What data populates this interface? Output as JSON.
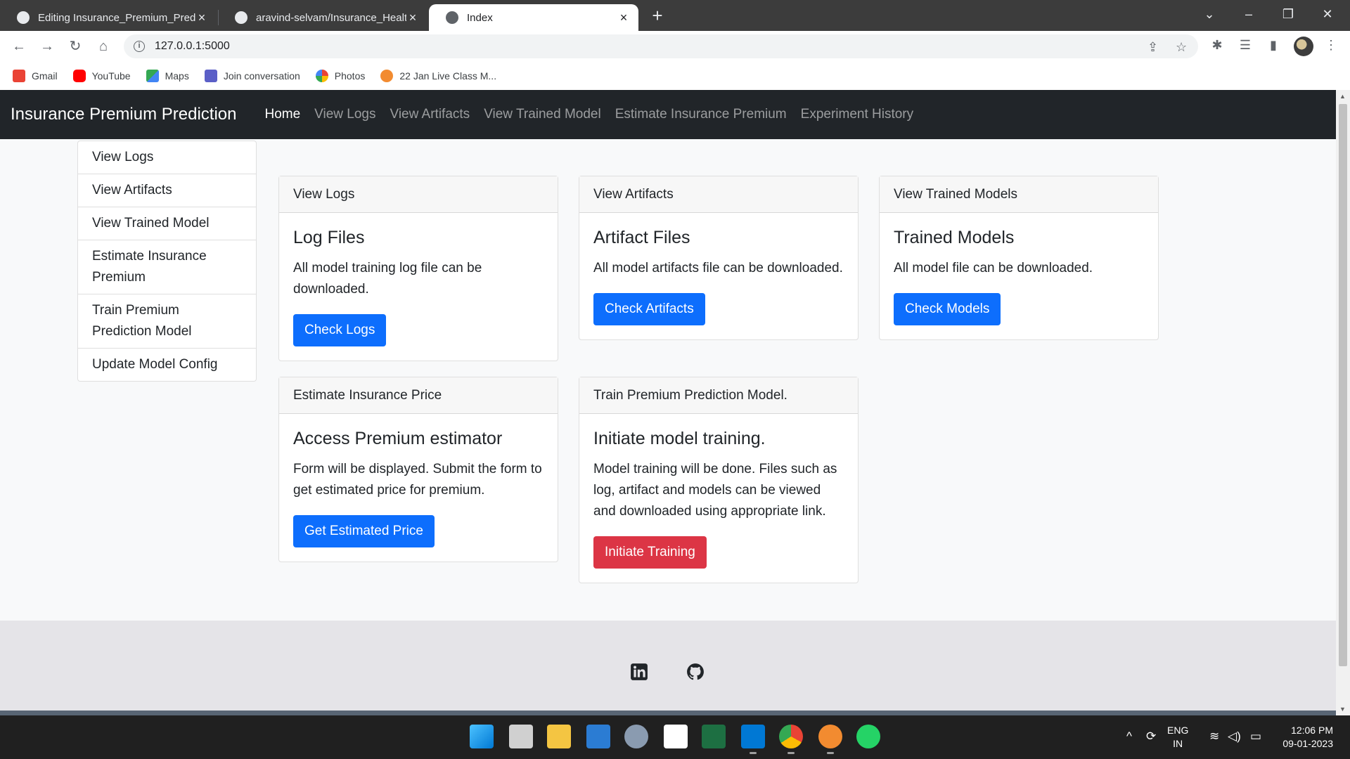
{
  "browser": {
    "tabs": [
      {
        "label": "Editing Insurance_Premium_Pred"
      },
      {
        "label": "aravind-selvam/Insurance_Health"
      },
      {
        "label": "Index"
      }
    ],
    "new_tab_glyph": "+",
    "url": "127.0.0.1:5000",
    "bookmarks": [
      {
        "label": "Gmail",
        "icon": "gmail-icon",
        "color": "#ea4335"
      },
      {
        "label": "YouTube",
        "icon": "youtube-icon",
        "color": "#ff0000"
      },
      {
        "label": "Maps",
        "icon": "maps-icon",
        "color": "#34a853"
      },
      {
        "label": "Join conversation",
        "icon": "teams-icon",
        "color": "#5b5fc7"
      },
      {
        "label": "Photos",
        "icon": "photos-icon",
        "color": "#fbbc04"
      },
      {
        "label": "22 Jan Live Class M...",
        "icon": "class-icon",
        "color": "#f28b30"
      }
    ]
  },
  "navbar": {
    "brand": "Insurance Premium Prediction",
    "links": [
      {
        "label": "Home",
        "active": true
      },
      {
        "label": "View Logs"
      },
      {
        "label": "View Artifacts"
      },
      {
        "label": "View Trained Model"
      },
      {
        "label": "Estimate Insurance Premium"
      },
      {
        "label": "Experiment History"
      }
    ]
  },
  "sidebar": {
    "items": [
      {
        "label": "View Logs"
      },
      {
        "label": "View Artifacts"
      },
      {
        "label": "View Trained Model"
      },
      {
        "label": "Estimate Insurance Premium"
      },
      {
        "label": "Train Premium Prediction Model"
      },
      {
        "label": "Update Model Config"
      }
    ]
  },
  "cards": [
    {
      "header": "View Logs",
      "title": "Log Files",
      "text": "All model training log file can be downloaded.",
      "button": "Check Logs",
      "variant": "primary"
    },
    {
      "header": "View Artifacts",
      "title": "Artifact Files",
      "text": "All model artifacts file can be downloaded.",
      "button": "Check Artifacts",
      "variant": "primary"
    },
    {
      "header": "View Trained Models",
      "title": "Trained Models",
      "text": "All model file can be downloaded.",
      "button": "Check Models",
      "variant": "primary"
    },
    {
      "header": "Estimate Insurance Price",
      "title": "Access Premium estimator",
      "text": "Form will be displayed. Submit the form to get estimated price for premium.",
      "button": "Get Estimated Price",
      "variant": "primary"
    },
    {
      "header": "Train Premium Prediction Model.",
      "title": "Initiate model training.",
      "text": "Model training will be done. Files such as log, artifact and models can be viewed and downloaded using appropriate link.",
      "button": "Initiate Training",
      "variant": "danger"
    }
  ],
  "footer": {
    "icons": [
      "linkedin-icon",
      "github-icon"
    ]
  },
  "taskbar": {
    "language": {
      "line1": "ENG",
      "line2": "IN"
    },
    "time": "12:06 PM",
    "date": "09-01-2023"
  },
  "colors": {
    "primary": "#0d6efd",
    "danger": "#dc3545",
    "navbar": "#212529"
  }
}
